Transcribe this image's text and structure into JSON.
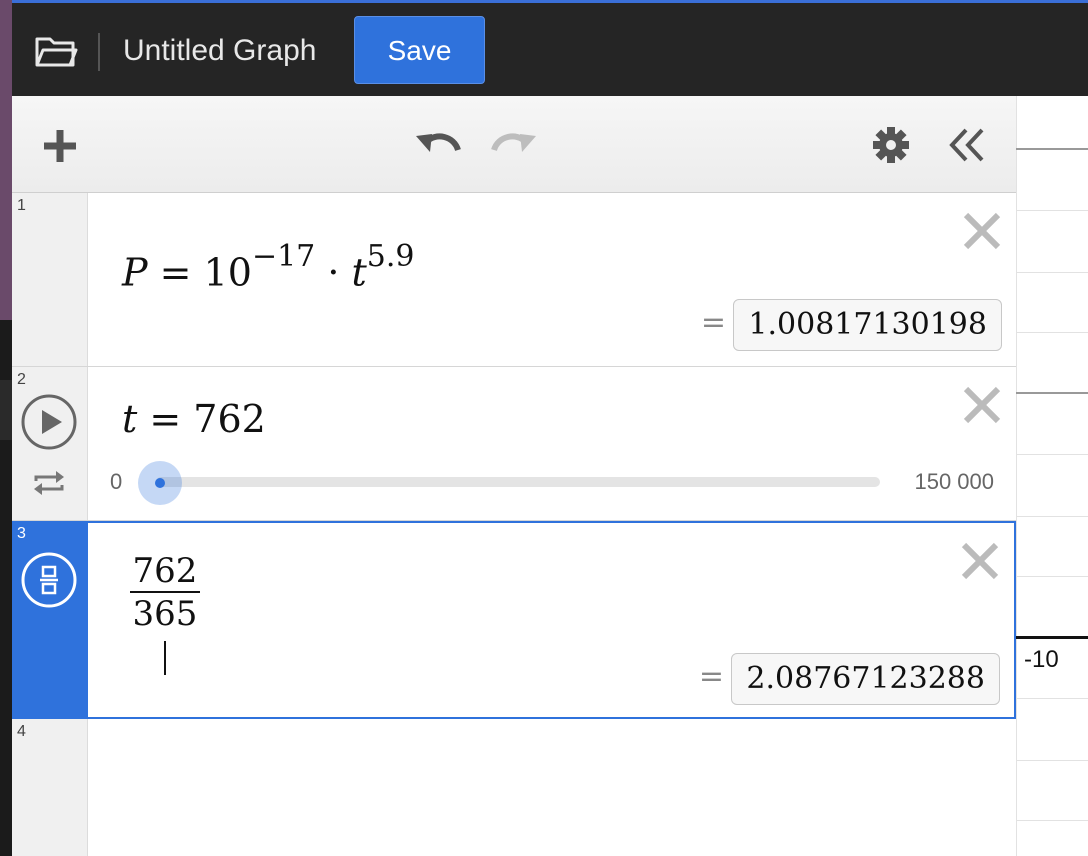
{
  "header": {
    "title": "Untitled Graph",
    "save_label": "Save"
  },
  "toolbar": {
    "add_icon": "plus-icon",
    "undo_icon": "undo-icon",
    "redo_icon": "redo-icon",
    "settings_icon": "gear-icon",
    "collapse_icon": "double-chevron-left-icon"
  },
  "expressions": [
    {
      "index": "1",
      "lhs": "P",
      "base": "10",
      "exp1": "−17",
      "var": "t",
      "exp2": "5.9",
      "result": "1.00817130198"
    },
    {
      "index": "2",
      "var": "t",
      "value": "762",
      "slider_min": "0",
      "slider_max": "150 000",
      "slider_fraction": 0.0051
    },
    {
      "index": "3",
      "numerator": "762",
      "denominator": "365",
      "result": "2.08767123288"
    },
    {
      "index": "4"
    }
  ],
  "graph": {
    "tick_label": "-10"
  },
  "colors": {
    "accent": "#2f72dc",
    "topbar": "#252525"
  }
}
